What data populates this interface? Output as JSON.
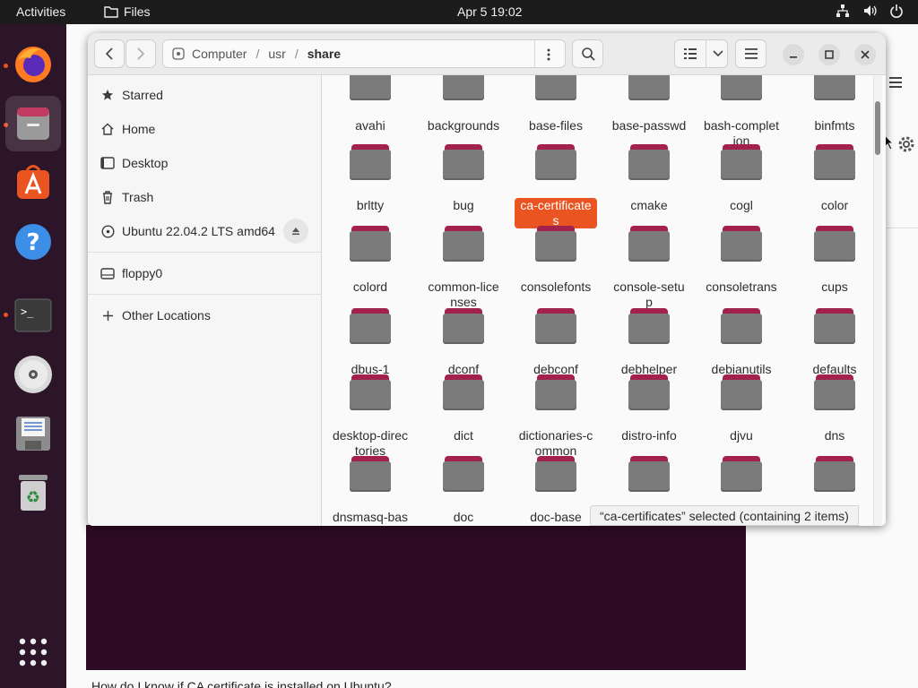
{
  "topbar": {
    "activities": "Activities",
    "app_name": "Files",
    "clock": "Apr 5  19:02",
    "tray_icons": [
      "network-icon",
      "volume-icon",
      "power-icon"
    ]
  },
  "dock": {
    "items": [
      {
        "name": "firefox",
        "running": true
      },
      {
        "name": "files",
        "running": true,
        "active": true
      },
      {
        "name": "app-center",
        "running": false
      },
      {
        "name": "help",
        "running": false
      },
      {
        "name": "terminal",
        "running": true
      },
      {
        "name": "dvd",
        "running": false
      },
      {
        "name": "floppy",
        "running": false
      },
      {
        "name": "trash",
        "running": false
      },
      {
        "name": "show-apps",
        "running": false
      }
    ]
  },
  "background": {
    "caption": "How do I know if CA certificate is installed on Ubuntu?"
  },
  "window": {
    "path": [
      "Computer",
      "usr",
      "share"
    ],
    "sidebar": {
      "items": [
        {
          "label": "Starred",
          "icon": "star-icon"
        },
        {
          "label": "Home",
          "icon": "home-icon"
        },
        {
          "label": "Desktop",
          "icon": "desktop-icon"
        },
        {
          "label": "Trash",
          "icon": "trash-icon"
        },
        {
          "label": "Ubuntu 22.04.2 LTS amd64",
          "icon": "disc-icon"
        },
        {
          "label": "floppy0",
          "icon": "drive-icon"
        },
        {
          "label": "Other Locations",
          "icon": "plus-icon"
        }
      ]
    },
    "folders": [
      [
        "avahi",
        "backgrounds",
        "base-files",
        "base-passwd",
        "bash-completion",
        "binfmts"
      ],
      [
        "brltty",
        "bug",
        "ca-certificates",
        "cmake",
        "cogl",
        "color"
      ],
      [
        "colord",
        "common-licenses",
        "consolefonts",
        "console-setup",
        "consoletrans",
        "cups"
      ],
      [
        "dbus-1",
        "dconf",
        "debconf",
        "debhelper",
        "debianutils",
        "defaults"
      ],
      [
        "desktop-directories",
        "dict",
        "dictionaries-common",
        "distro-info",
        "djvu",
        "dns"
      ],
      [
        "dnsmasq-base",
        "doc",
        "doc-base",
        "",
        "",
        ""
      ]
    ],
    "selected": "ca-certificates",
    "status": "“ca-certificates” selected  (containing 2 items)",
    "colors": {
      "accent": "#e95420",
      "folder_tab": "#a3214d",
      "folder_body": "#7b7b7b"
    }
  }
}
